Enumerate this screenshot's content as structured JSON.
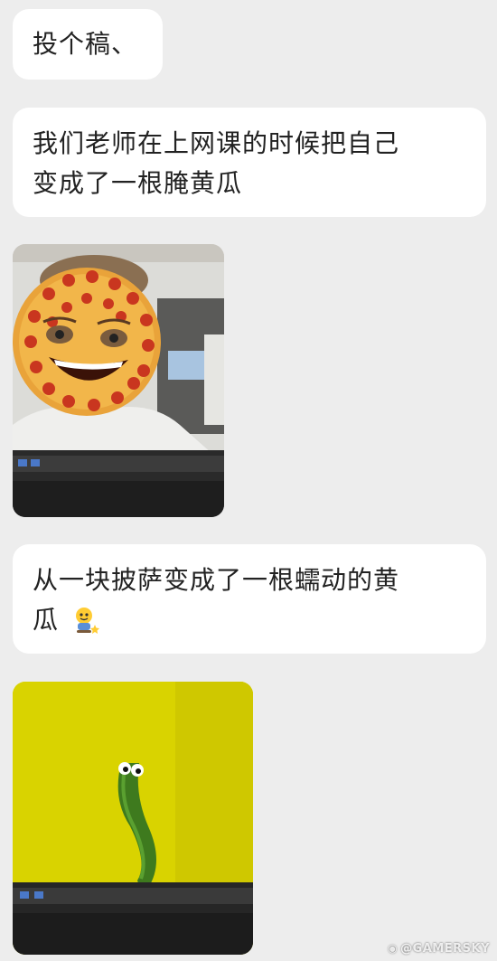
{
  "messages": [
    {
      "text": "投个稿、"
    },
    {
      "text_line1": "我们老师在上网课的时候把自己",
      "text_line2": "变成了一根腌黄瓜"
    },
    {
      "text_line1": "从一块披萨变成了一根蠕动的黄",
      "text_line2": "瓜"
    }
  ],
  "images": [
    {
      "description": "pizza-face-filter-screenshot"
    },
    {
      "description": "cucumber-filter-screenshot"
    }
  ],
  "watermark": {
    "text": "@GAMERSKY"
  },
  "colors": {
    "background": "#ededed",
    "bubble": "#ffffff",
    "text": "#222222"
  },
  "icons": {
    "emoji": "smiling-emoji-icon"
  }
}
